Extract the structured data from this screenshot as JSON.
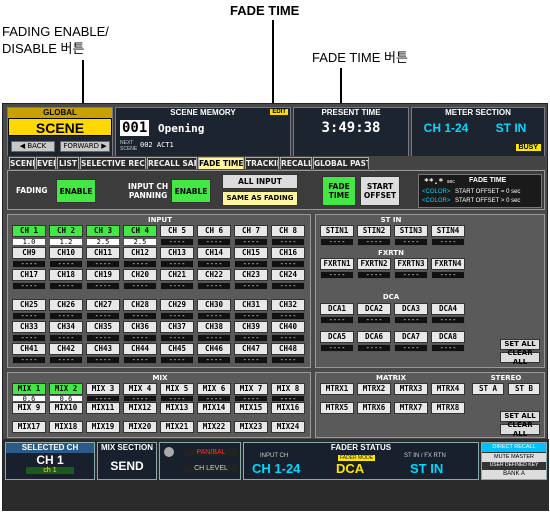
{
  "callouts": {
    "fade_time_title": "FADE TIME",
    "fading_enable_line1": "FADING ENABLE/",
    "fading_enable_line2": "DISABLE 버튼",
    "fade_time_button": "FADE TIME 버튼"
  },
  "header": {
    "global_label": "GLOBAL",
    "global_value": "SCENE",
    "back": "◀ BACK",
    "forward": "FORWARD ▶",
    "scene_memory_label": "SCENE MEMORY",
    "edit_badge": "EDIT",
    "scene_number": "001",
    "scene_name": "Opening",
    "next_label": "NEXT\nSCENE",
    "next_value": "002 ACT1",
    "present_time_label": "PRESENT TIME",
    "present_time": "3:49:38",
    "meter_section_label": "METER SECTION",
    "meter_ch": "CH 1-24",
    "meter_stin": "ST IN",
    "busy": "BUSY"
  },
  "tabs": [
    "SCENE",
    "EVENT",
    "LIST",
    "SELECTIVE RECALL",
    "RECALL SAFE",
    "FADE TIME",
    "TRACKING",
    "RECALL",
    "GLOBAL PASTE"
  ],
  "controls": {
    "fading_label": "FADING",
    "fading_enable": "ENABLE",
    "input_ch_panning_label": "INPUT CH\nPANNING",
    "panning_enable": "ENABLE",
    "all_input": "ALL INPUT",
    "same_as_fading": "SAME AS FADING",
    "fade_time_btn": "FADE\nTIME",
    "start_offset_btn": "START\nOFFSET",
    "legend_value": "**.*",
    "legend_unit": "sec",
    "legend_title": "FADE TIME",
    "legend_color1": "<COLOR>",
    "legend_text1": "START OFFSET = 0 sec",
    "legend_color2": "<COLOR>",
    "legend_text2": "START OFFSET > 0 sec"
  },
  "input": {
    "title": "INPUT",
    "channels": [
      "CH 1",
      "CH 2",
      "CH 3",
      "CH 4",
      "CH 5",
      "CH 6",
      "CH 7",
      "CH 8",
      "CH9",
      "CH10",
      "CH11",
      "CH12",
      "CH13",
      "CH14",
      "CH15",
      "CH16",
      "CH17",
      "CH18",
      "CH19",
      "CH20",
      "CH21",
      "CH22",
      "CH23",
      "CH24",
      "CH25",
      "CH26",
      "CH27",
      "CH28",
      "CH29",
      "CH30",
      "CH31",
      "CH32",
      "CH33",
      "CH34",
      "CH35",
      "CH36",
      "CH37",
      "CH38",
      "CH39",
      "CH40",
      "CH41",
      "CH42",
      "CH43",
      "CH44",
      "CH45",
      "CH46",
      "CH47",
      "CH48"
    ],
    "values": [
      "1.0",
      "1.2",
      "2.5",
      "2.5",
      "----",
      "----",
      "----",
      "----"
    ],
    "active": [
      true,
      true,
      true,
      true,
      false,
      false,
      false,
      false
    ]
  },
  "st_in": {
    "title": "ST IN",
    "channels": [
      "STIN1",
      "STIN2",
      "STIN3",
      "STIN4"
    ]
  },
  "fxrtn": {
    "title": "FXRTN",
    "channels": [
      "FXRTN1",
      "FXRTN2",
      "FXRTN3",
      "FXRTN4"
    ]
  },
  "dca": {
    "title": "DCA",
    "channels": [
      "DCA1",
      "DCA2",
      "DCA3",
      "DCA4",
      "DCA5",
      "DCA6",
      "DCA7",
      "DCA8"
    ]
  },
  "set_all": "SET ALL",
  "clear_all": "CLEAR ALL",
  "mix": {
    "title": "MIX",
    "channels": [
      "MIX 1",
      "MIX 2",
      "MIX 3",
      "MIX 4",
      "MIX 5",
      "MIX 6",
      "MIX 7",
      "MIX 8",
      "MIX 9",
      "MIX10",
      "MIX11",
      "MIX12",
      "MIX13",
      "MIX14",
      "MIX15",
      "MIX16",
      "MIX17",
      "MIX18",
      "MIX19",
      "MIX20",
      "MIX21",
      "MIX22",
      "MIX23",
      "MIX24"
    ],
    "values": [
      "0.6",
      "0.6"
    ]
  },
  "matrix": {
    "title": "MATRIX",
    "channels": [
      "MTRX1",
      "MTRX2",
      "MTRX3",
      "MTRX4",
      "MTRX5",
      "MTRX6",
      "MTRX7",
      "MTRX8"
    ]
  },
  "stereo": {
    "title": "STEREO",
    "channels": [
      "ST A",
      "ST B"
    ]
  },
  "dash": "----",
  "footer": {
    "selected_ch_label": "SELECTED CH",
    "selected_ch": "CH 1",
    "selected_sub": "ch 1",
    "mix_section_label": "MIX SECTION",
    "mix_section": "SEND",
    "pan_bal": "PAN/BAL",
    "ch_level": "CH LEVEL",
    "fader_status_label": "FADER STATUS",
    "input_ch_label": "INPUT CH",
    "input_ch": "CH 1-24",
    "fader_mode_label": "FADER MODE",
    "fader_mode": "DCA",
    "stin_fxrtn_label": "ST IN / FX RTN",
    "stin_value": "ST IN",
    "direct_recall": "DIRECT RECALL",
    "mute_master": "MUTE MASTER",
    "user_defined": "USER DEFINED KEY",
    "bank": "BANK A"
  },
  "colors": {
    "accent_green": "#44e844",
    "tab_active": "#fff6a0",
    "header_cyan": "#00d8ff",
    "busy_yellow": "#ffe600"
  }
}
